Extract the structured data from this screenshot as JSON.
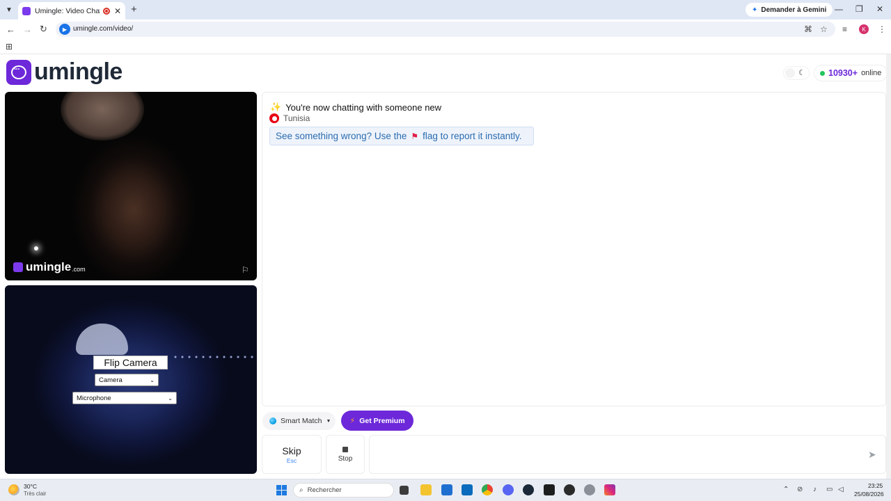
{
  "browser": {
    "tab_title": "Umingle: Video Chat with S",
    "new_tab": "+",
    "gemini_label": "Demander à Gemini",
    "url": "umingle.com/video/",
    "profile_initial": "K"
  },
  "header": {
    "logo_text": "umingle",
    "online_count": "10930+",
    "online_label": "online"
  },
  "remote_video": {
    "watermark": "umingle",
    "watermark_tld": ".com"
  },
  "local_video": {
    "flip_label": "Flip Camera",
    "camera_select": "Camera",
    "microphone_select": "Microphone"
  },
  "chat": {
    "new_chat_text": "You're now chatting with someone new",
    "country": "Tunisia",
    "report_prefix": "See something wrong? Use the",
    "report_suffix": "flag to report it instantly."
  },
  "controls": {
    "smart_match_label": "Smart Match",
    "premium_label": "Get Premium",
    "skip_label": "Skip",
    "skip_key": "Esc",
    "stop_label": "Stop",
    "message_placeholder": ""
  },
  "taskbar": {
    "temperature": "30°C",
    "weather": "Très clair",
    "search_label": "Rechercher",
    "time": "23:25",
    "date": "25/08/2026"
  },
  "colors": {
    "brand": "#6d28d9",
    "online": "#22c55e",
    "report_text": "#2b6cb0"
  }
}
